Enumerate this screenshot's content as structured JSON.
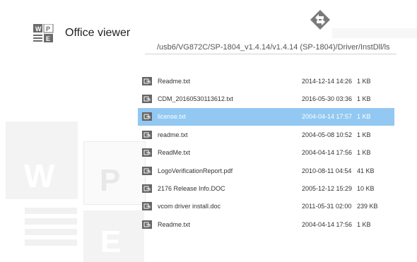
{
  "app": {
    "title": "Office viewer"
  },
  "path": "/usb6/VG872C/SP-1804_v1.4.14/v1.4.14 (SP-1804)/Driver/InstDll/ls",
  "watermark": {
    "w": "W",
    "p": "P",
    "e": "E"
  },
  "colors": {
    "selected_row": "#92c8f2",
    "icon": "#666666"
  },
  "files": [
    {
      "name": "Readme.txt",
      "date": "2014-12-14 14:26",
      "size": "1 KB",
      "selected": false
    },
    {
      "name": "CDM_20160530113612.txt",
      "date": "2016-05-30 03:36",
      "size": "1 KB",
      "selected": false
    },
    {
      "name": "license.txt",
      "date": "2004-04-14 17:57",
      "size": "1 KB",
      "selected": true
    },
    {
      "name": "readme.txt",
      "date": "2004-05-08 10:52",
      "size": "1 KB",
      "selected": false
    },
    {
      "name": "ReadMe.txt",
      "date": "2004-04-14 17:56",
      "size": "1 KB",
      "selected": false
    },
    {
      "name": "LogoVerificationReport.pdf",
      "date": "2010-08-11 04:54",
      "size": "41 KB",
      "selected": false
    },
    {
      "name": "2176 Release Info.DOC",
      "date": "2005-12-12 15:29",
      "size": "10 KB",
      "selected": false
    },
    {
      "name": "vcom driver install.doc",
      "date": "2011-05-31 02:00",
      "size": "239 KB",
      "selected": false
    },
    {
      "name": "Readme.txt",
      "date": "2004-04-14 17:56",
      "size": "1 KB",
      "selected": false
    }
  ]
}
